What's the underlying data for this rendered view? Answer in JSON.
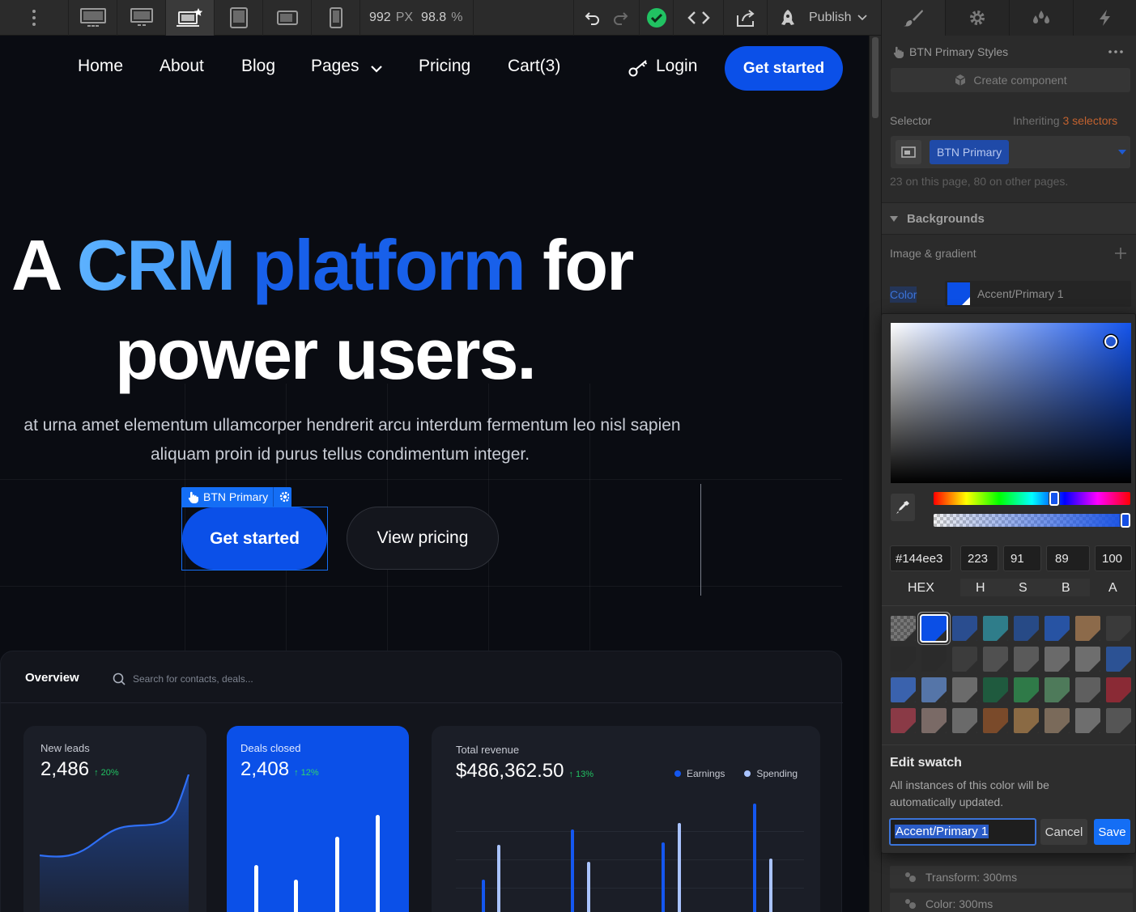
{
  "toolbar": {
    "width_value": "992",
    "width_unit": "PX",
    "zoom_value": "98.8",
    "zoom_unit": "%",
    "publish_label": "Publish"
  },
  "site": {
    "nav": {
      "home": "Home",
      "about": "About",
      "blog": "Blog",
      "pages": "Pages",
      "pricing": "Pricing",
      "cart": "Cart(3)",
      "login": "Login",
      "get_started": "Get started"
    },
    "hero": {
      "title_a": "A",
      "title_crm": "CRM",
      "title_platform": "platform",
      "title_for": "for",
      "title_line2": "power users.",
      "subtitle_line1": "at urna amet elementum ullamcorper hendrerit arcu interdum fermentum leo nisl sapien",
      "subtitle_line2": "aliquam proin id purus tellus condimentum integer.",
      "primary_cta": "Get started",
      "secondary_cta": "View pricing"
    },
    "selection_tag": "BTN Primary",
    "dashboard": {
      "tab_overview": "Overview",
      "search_placeholder": "Search for contacts, deals...",
      "cards": {
        "leads_label": "New leads",
        "leads_value": "2,486",
        "leads_pct": "20%",
        "deals_label": "Deals closed",
        "deals_value": "2,408",
        "deals_pct": "12%",
        "revenue_label": "Total revenue",
        "revenue_value": "$486,362.50",
        "revenue_pct": "13%",
        "legend_earnings": "Earnings",
        "legend_spending": "Spending"
      }
    }
  },
  "panel": {
    "style_title": "BTN Primary Styles",
    "create_component": "Create component",
    "selector_label": "Selector",
    "inheriting_prefix": "Inheriting",
    "inheriting_count": "3 selectors",
    "selector_chip": "BTN Primary",
    "usage_text": "23 on this page, 80 on other pages.",
    "backgrounds_title": "Backgrounds",
    "image_gradient_label": "Image & gradient",
    "color_label": "Color",
    "color_name": "Accent/Primary 1",
    "transition_1": "Transform: 300ms",
    "transition_2": "Color: 300ms"
  },
  "picker": {
    "hex": "#144ee3",
    "h": "223",
    "s": "91",
    "b": "89",
    "a": "100",
    "hex_label": "HEX",
    "h_label": "H",
    "s_label": "S",
    "b_label": "B",
    "a_label": "A",
    "edit_swatch_title": "Edit swatch",
    "edit_swatch_desc_1": "All instances of this color will be",
    "edit_swatch_desc_2": "automatically updated.",
    "swatch_name_value": "Accent/Primary 1",
    "cancel_label": "Cancel",
    "save_label": "Save",
    "swatches": [
      [
        "#6a6a6a",
        "#0b4fe6",
        "#2a4d8f",
        "#2f7d8a",
        "#274a86",
        "#2753a3",
        "#8c6a4a",
        "#3a3a3a"
      ],
      [
        "#2b2b2b",
        "#2b2b2b",
        "#3c3c3c",
        "#505050",
        "#5a5a5a",
        "#6a6a6a",
        "#6e6e6e",
        "#2c5294"
      ],
      [
        "#3a62ad",
        "#5575a8",
        "#6b6b6b",
        "#1f5a3e",
        "#2f7a48",
        "#4e7a5a",
        "#5f5f5f",
        "#8a2a35"
      ],
      [
        "#8a3a46",
        "#7a6a66",
        "#6a6a6a",
        "#7a4a2a",
        "#8a6a44",
        "#7a6a5a",
        "#6e6e6e",
        "#555555"
      ]
    ]
  },
  "colors": {
    "accent": "#0b50e8",
    "crm_gradient_start": "#4aa8ff",
    "platform_blue": "#1a5ee6",
    "positive": "#21c262"
  }
}
